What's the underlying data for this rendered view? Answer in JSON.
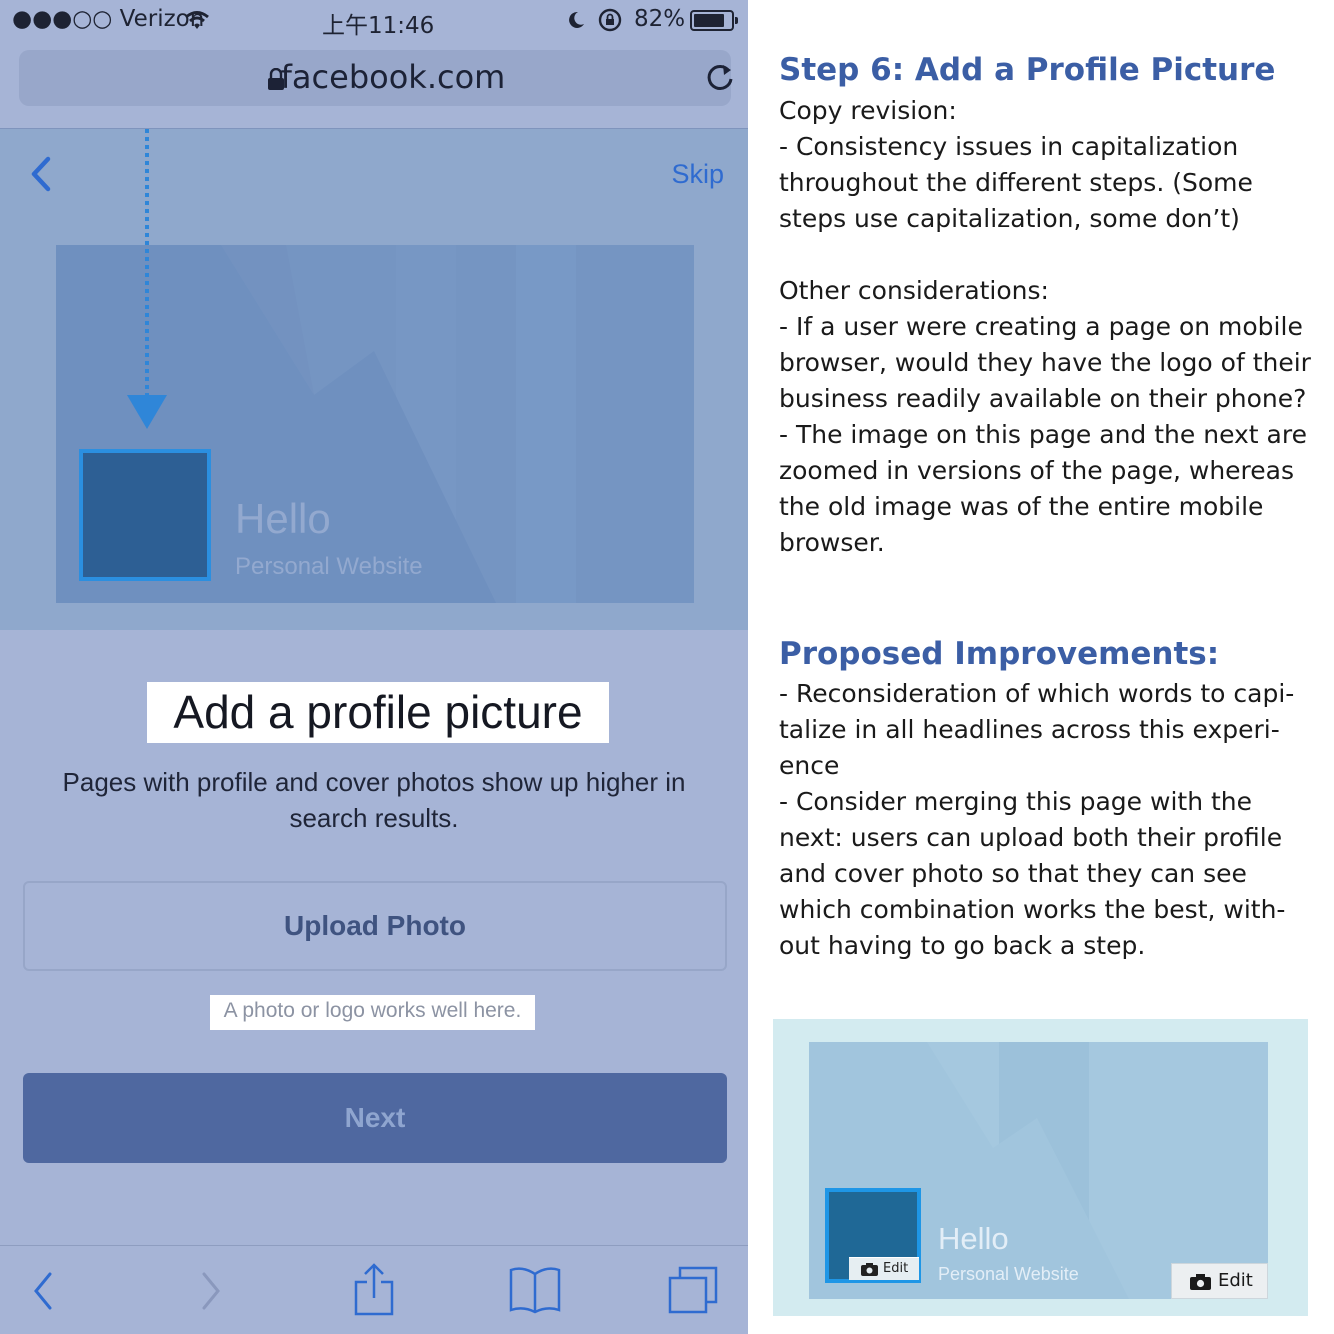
{
  "status_bar": {
    "carrier": "●●●○○ Verizon",
    "time": "上午11:46",
    "battery_percent": "82%",
    "battery_level": 0.82
  },
  "browser": {
    "url": "facebook.com"
  },
  "page": {
    "skip_label": "Skip",
    "preview": {
      "name": "Hello",
      "category": "Personal Website"
    },
    "headline": "Add a profile picture",
    "subtext": "Pages with profile and cover photos show up higher in search results.",
    "upload_button": "Upload Photo",
    "hint": "A photo or logo works well here.",
    "next_button": "Next"
  },
  "icons": {
    "back": "chevron-left-icon",
    "lock": "lock-icon",
    "reload": "reload-icon",
    "wifi": "wifi-icon",
    "moon": "moon-icon",
    "rotation_lock": "rotation-lock-icon",
    "share": "share-icon",
    "bookmarks": "bookmarks-icon",
    "tabs": "tabs-icon",
    "camera": "camera-icon"
  },
  "annotation": {
    "step_title": "Step 6: Add a Profile Picture",
    "body_lines": [
      "Copy revision:",
      "- Consistency issues in capitalization",
      "throughout the different steps. (Some",
      "steps use capitalization, some don’t)",
      "",
      "Other considerations:",
      "- If a user were creating a page on mobile",
      "browser, would they have the logo of their",
      "business readily available on their phone?",
      "- The image on this page and the next are",
      "zoomed in versions of the page, whereas",
      "the old image was of the entire mobile",
      "browser."
    ],
    "improvements_title": "Proposed Improvements:",
    "improvement_lines": [
      "- Reconsideration of which words to capi-",
      "talize in all headlines across this experi-",
      "ence",
      "- Consider merging this page with the",
      "next: users can upload both their profile",
      "and cover photo so that they can see",
      "which combination works the best, with-",
      "out having to go back a step."
    ],
    "mockup": {
      "name": "Hello",
      "category": "Personal Website",
      "edit_small": "Edit",
      "edit_large": "Edit"
    }
  },
  "colors": {
    "facebook_blue": "#4f68a0",
    "ios_link_blue": "#2f6bd0",
    "heading_blue": "#3b5ea5",
    "overlay_tint": "#a6b4d6"
  }
}
